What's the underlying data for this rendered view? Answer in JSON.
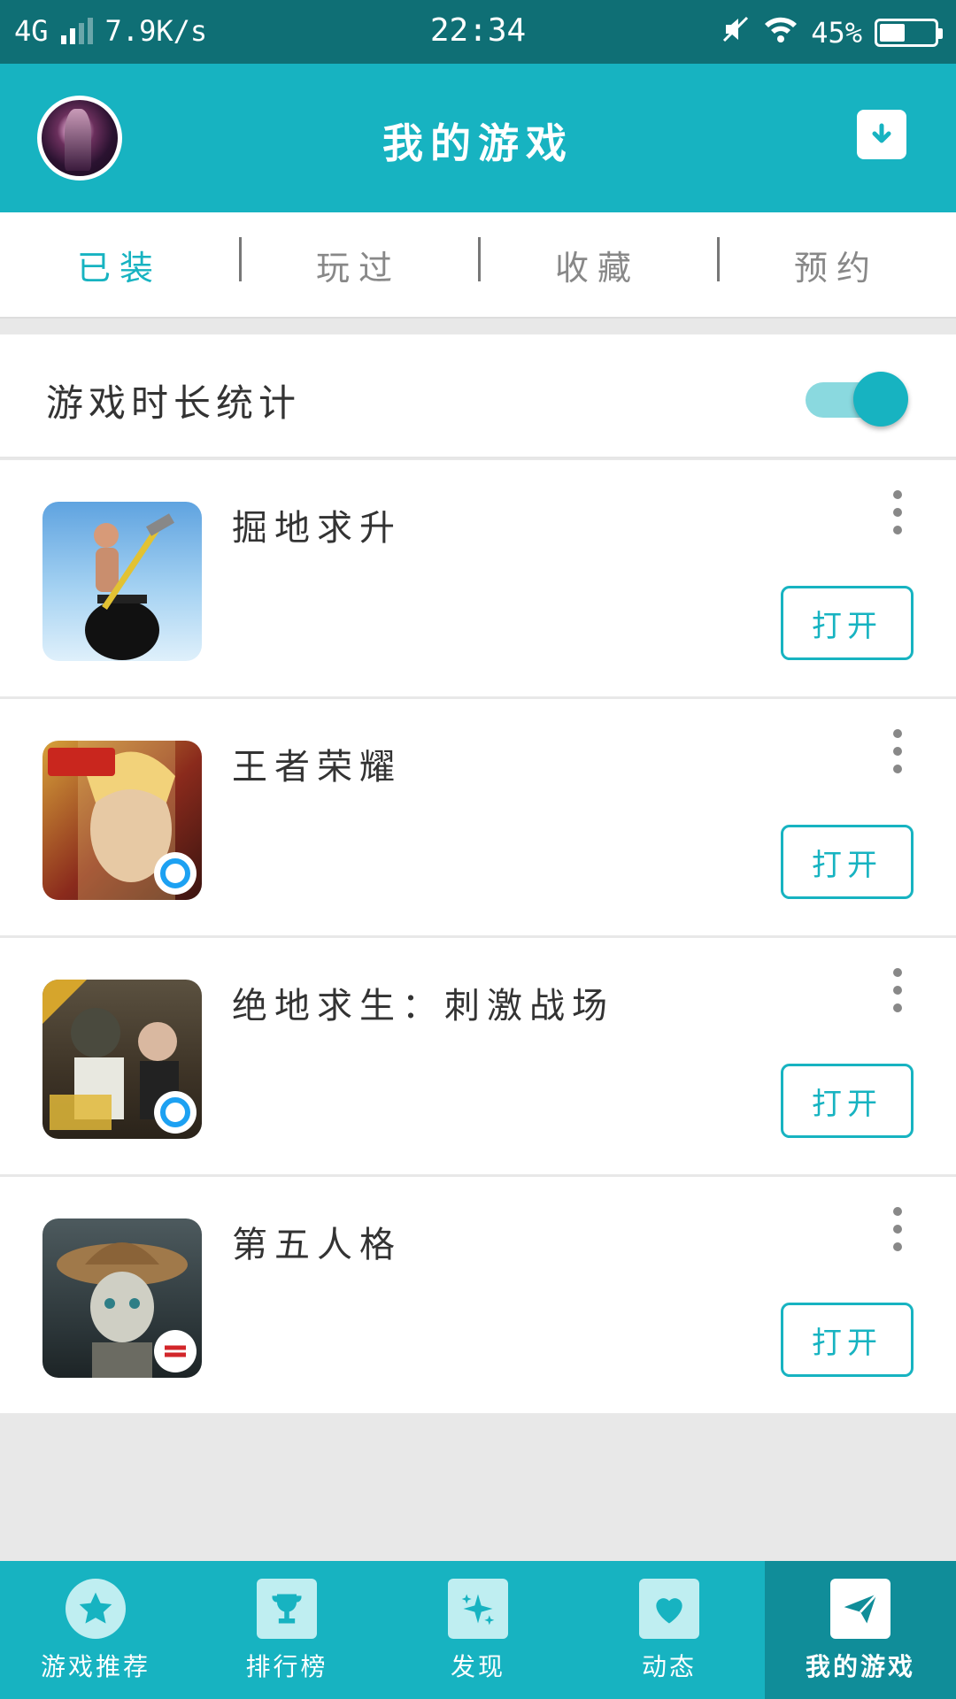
{
  "status_bar": {
    "network": "4G",
    "speed": "7.9K/s",
    "time": "22:34",
    "battery": "45%",
    "battery_level": 0.45
  },
  "header": {
    "title": "我的游戏",
    "download_icon": "download-box-icon",
    "accent": "#17b3c1"
  },
  "tabs": [
    {
      "label": "已装",
      "active": true
    },
    {
      "label": "玩过",
      "active": false
    },
    {
      "label": "收藏",
      "active": false
    },
    {
      "label": "预约",
      "active": false
    }
  ],
  "stats_toggle": {
    "label": "游戏时长统计",
    "enabled": true
  },
  "games": [
    {
      "name": "掘地求升",
      "button": "打开"
    },
    {
      "name": "王者荣耀",
      "button": "打开"
    },
    {
      "name": "绝地求生：刺激战场",
      "button": "打开"
    },
    {
      "name": "第五人格",
      "button": "打开"
    }
  ],
  "bottom_nav": [
    {
      "label": "游戏推荐",
      "icon": "star-icon",
      "active": false
    },
    {
      "label": "排行榜",
      "icon": "trophy-icon",
      "active": false
    },
    {
      "label": "发现",
      "icon": "sparkle-icon",
      "active": false
    },
    {
      "label": "动态",
      "icon": "heart-icon",
      "active": false
    },
    {
      "label": "我的游戏",
      "icon": "paper-plane-icon",
      "active": true
    }
  ]
}
